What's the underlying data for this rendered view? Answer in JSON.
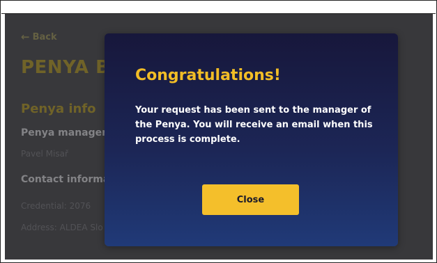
{
  "page": {
    "back_label": "Back",
    "title": "PENYA BA",
    "section_title": "Penya info",
    "manager_label": "Penya manager",
    "manager_name": "Pavel Misař",
    "contact_label": "Contact informat",
    "credential": "Credential: 2076",
    "address": "Address: ALDEA Slo"
  },
  "modal": {
    "title": "Congratulations!",
    "message": "Your request has been sent to the manager of the Penya. You will receive an email when this process is complete.",
    "close_label": "Close"
  },
  "colors": {
    "accent": "#f4bf2b",
    "modal_top": "#17173b",
    "modal_bottom": "#203a78",
    "background": "#3d3d41"
  },
  "icons": {
    "back": "arrow-left-icon"
  }
}
